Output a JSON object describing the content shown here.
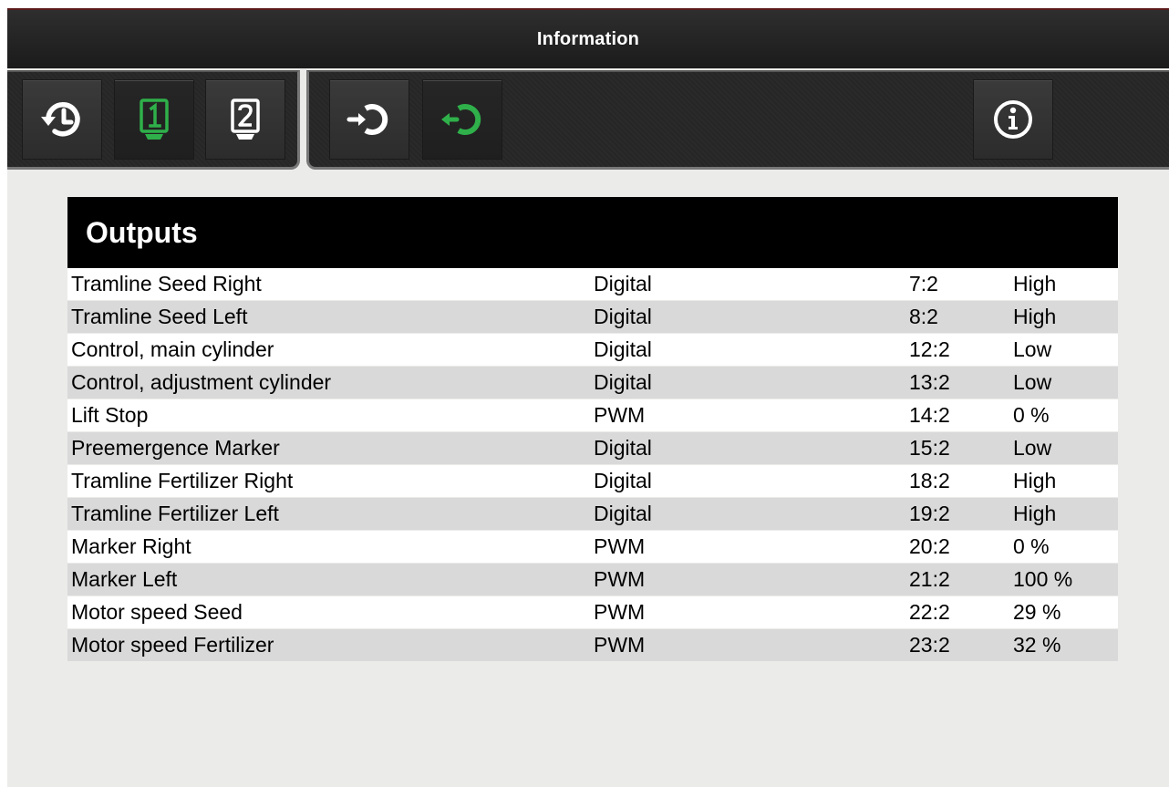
{
  "window": {
    "title": "Information"
  },
  "toolbar": {
    "left_buttons": [
      {
        "name": "history-icon",
        "state": "normal"
      },
      {
        "name": "ecu-1-icon",
        "label": "1",
        "state": "active",
        "color": "#2fb04a"
      },
      {
        "name": "ecu-2-icon",
        "label": "2",
        "state": "normal"
      }
    ],
    "right_buttons": [
      {
        "name": "inputs-icon",
        "state": "normal"
      },
      {
        "name": "outputs-icon",
        "state": "active",
        "color": "#2fb04a"
      },
      {
        "name": "info-icon",
        "state": "normal"
      }
    ]
  },
  "section": {
    "title": "Outputs"
  },
  "outputs": [
    {
      "name": "Tramline Seed Right",
      "type": "Digital",
      "port": "7:2",
      "value": "High"
    },
    {
      "name": "Tramline Seed Left",
      "type": "Digital",
      "port": "8:2",
      "value": "High"
    },
    {
      "name": "Control, main cylinder",
      "type": "Digital",
      "port": "12:2",
      "value": "Low"
    },
    {
      "name": "Control, adjustment cylinder",
      "type": "Digital",
      "port": "13:2",
      "value": "Low"
    },
    {
      "name": "Lift Stop",
      "type": "PWM",
      "port": "14:2",
      "value": "0 %"
    },
    {
      "name": "Preemergence Marker",
      "type": "Digital",
      "port": "15:2",
      "value": "Low"
    },
    {
      "name": "Tramline Fertilizer Right",
      "type": "Digital",
      "port": "18:2",
      "value": "High"
    },
    {
      "name": "Tramline Fertilizer Left",
      "type": "Digital",
      "port": "19:2",
      "value": "High"
    },
    {
      "name": "Marker Right",
      "type": "PWM",
      "port": "20:2",
      "value": "0 %"
    },
    {
      "name": "Marker Left",
      "type": "PWM",
      "port": "21:2",
      "value": "100 %"
    },
    {
      "name": "Motor speed Seed",
      "type": "PWM",
      "port": "22:2",
      "value": "29 %"
    },
    {
      "name": "Motor speed Fertilizer",
      "type": "PWM",
      "port": "23:2",
      "value": "32 %"
    }
  ]
}
